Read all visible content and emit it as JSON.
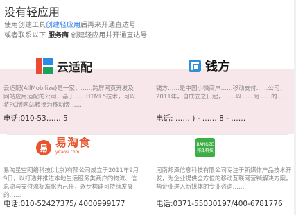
{
  "header": {
    "title": "没有轻应用",
    "line1_prefix": "使用创建工具",
    "line1_link": "创建轻应用",
    "line1_suffix": "后再来开通直达号",
    "line2_prefix": "或者联系以下",
    "line2_bold": "服务商",
    "line2_suffix": "创建轻应用并开通直达号"
  },
  "vendors": [
    {
      "logo_text": "云适配",
      "desc": "云适配(AllMobilize)是一家，……跨屏网页开发及网站应用适配的公司，基于……HTML5技术，可以将PC版网站转换为移动版……",
      "phone": "电话:010-53…… 5"
    },
    {
      "logo_text": "钱方",
      "desc": "钱方……是中国小微商户……移动支付……公司，2011年，自成立之日起，……以……为……的……",
      "phone": "电话: …… ) - …… 8 - ……"
    },
    {
      "logo_text": "易淘食",
      "logo_sub": "yitaosi.com",
      "desc": "易淘星空网络科技(北京)有限公司成立于2011年9月9日，以打造并推进本地生活服务类商户的物流、信息流与支付流标准化为己任，逐步构建可持续发展的……",
      "phone": "电话:010-52427375/ 4000999177"
    },
    {
      "logo_text": "邦泽科技",
      "logo_sub": "BANGZE",
      "desc": "河南邦泽信息科技有限公司专注于新媒体产品技术开发，为企业提供全方位的移动互联网营销解决方案，帮企业进入新媒体的专业咨询……",
      "phone": "电话:0371-55030197/400-6781776"
    }
  ]
}
